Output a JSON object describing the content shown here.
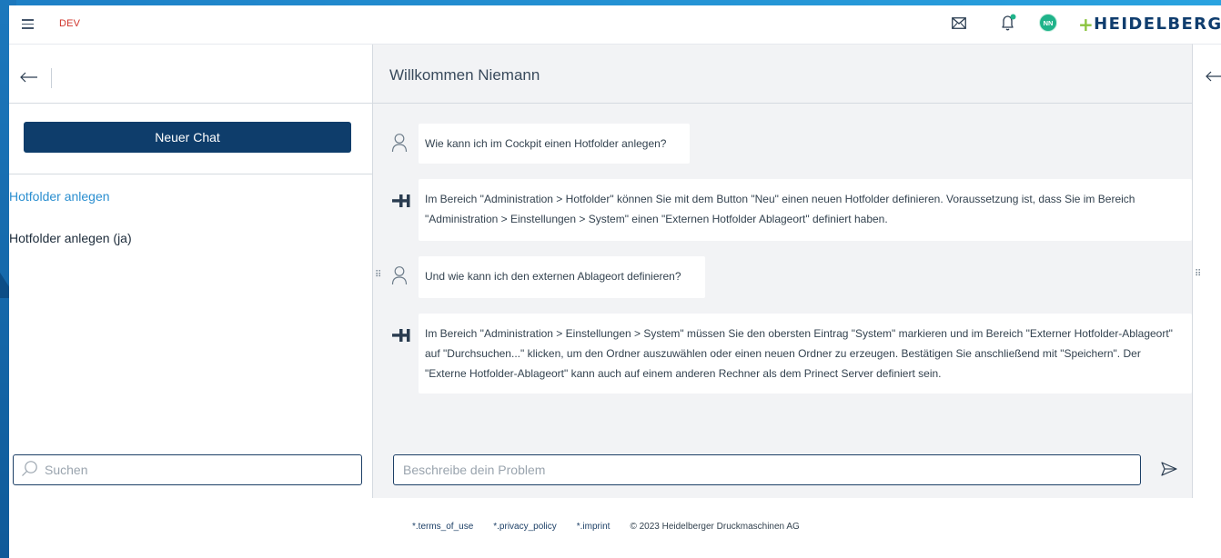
{
  "header": {
    "env_badge": "DEV",
    "avatar_initials": "NN",
    "logo_text": "HEIDELBERG",
    "icons": [
      "menu-icon",
      "mail-icon",
      "bell-icon"
    ],
    "notification_dot_color": "#1fb38a"
  },
  "sidebar": {
    "new_chat_label": "Neuer Chat",
    "history": [
      {
        "label": "Hotfolder anlegen",
        "active": true
      },
      {
        "label": "Hotfolder anlegen (ja)",
        "active": false
      }
    ],
    "search_placeholder": "Suchen"
  },
  "chat": {
    "title": "Willkommen Niemann",
    "messages": [
      {
        "role": "user",
        "text": "Wie kann ich im Cockpit einen Hotfolder anlegen?"
      },
      {
        "role": "assistant",
        "text": "Im Bereich \"Administration > Hotfolder\" können Sie mit dem Button \"Neu\" einen neuen Hotfolder definieren. Voraussetzung ist, dass Sie im Bereich \"Administration > Einstellungen > System\" einen \"Externen Hotfolder Ablageort\" definiert haben."
      },
      {
        "role": "user",
        "text": "Und wie kann ich den externen Ablageort definieren?"
      },
      {
        "role": "assistant",
        "text": "Im Bereich \"Administration > Einstellungen > System\" müssen Sie den obersten Eintrag \"System\" markieren und im Bereich \"Externer Hotfolder-Ablageort\" auf \"Durchsuchen...\" klicken, um den Ordner auszuwählen oder einen neuen Ordner zu erzeugen. Bestätigen Sie anschließend mit \"Speichern\". Der \"Externe Hotfolder-Ablageort\" kann auch auf einem anderen Rechner als dem Prinect Server definiert sein."
      }
    ],
    "input_placeholder": "Beschreibe dein Problem"
  },
  "footer": {
    "terms": "*.terms_of_use",
    "privacy": "*.privacy_policy",
    "imprint": "*.imprint",
    "copyright": "© 2023 Heidelberger Druckmaschinen AG"
  },
  "colors": {
    "primary": "#0e3d6b",
    "accent_link": "#2b8fd0",
    "background_blue": "#1a6eb0",
    "env_badge": "#d0342c",
    "logo_plus": "#8bc43f"
  }
}
